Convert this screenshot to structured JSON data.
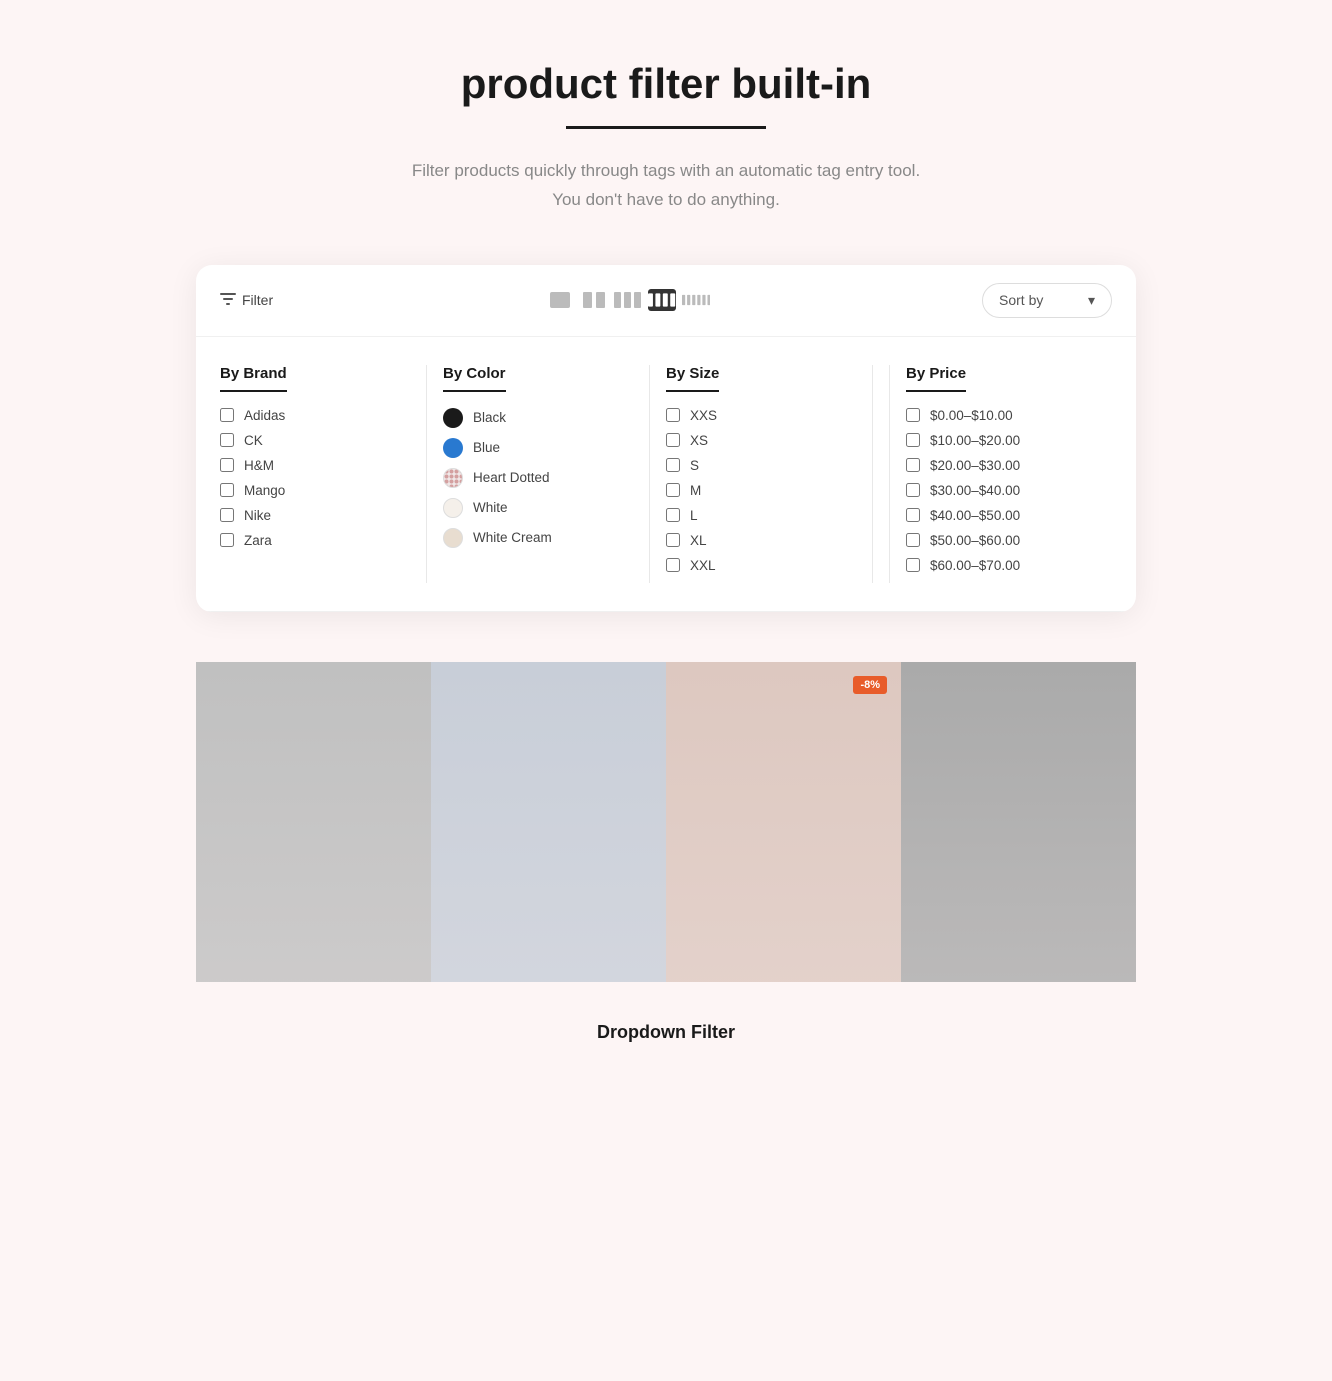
{
  "page": {
    "title": "product filter built-in",
    "subtitle_line1": "Filter products quickly through tags with an automatic tag entry tool.",
    "subtitle_line2": "You don't have to do anything.",
    "caption": "Dropdown Filter"
  },
  "toolbar": {
    "filter_label": "Filter",
    "sort_label": "Sort by"
  },
  "filter": {
    "brand": {
      "heading": "By Brand",
      "items": [
        "Adidas",
        "CK",
        "H&M",
        "Mango",
        "Nike",
        "Zara"
      ]
    },
    "color": {
      "heading": "By Color",
      "items": [
        {
          "name": "Black",
          "swatch": "black"
        },
        {
          "name": "Blue",
          "swatch": "blue"
        },
        {
          "name": "Heart Dotted",
          "swatch": "heart-dotted"
        },
        {
          "name": "White",
          "swatch": "white"
        },
        {
          "name": "White Cream",
          "swatch": "white-cream"
        }
      ]
    },
    "size": {
      "heading": "By Size",
      "items": [
        "XXS",
        "XS",
        "S",
        "M",
        "L",
        "XL",
        "XXL"
      ]
    },
    "price": {
      "heading": "By Price",
      "items": [
        "$0.00–$10.00",
        "$10.00–$20.00",
        "$20.00–$30.00",
        "$30.00–$40.00",
        "$40.00–$50.00",
        "$50.00–$60.00",
        "$60.00–$70.00"
      ]
    }
  },
  "products": [
    {
      "id": 1,
      "bg": "prod1",
      "discount": null
    },
    {
      "id": 2,
      "bg": "prod2",
      "discount": null
    },
    {
      "id": 3,
      "bg": "prod3",
      "discount": "-8%"
    },
    {
      "id": 4,
      "bg": "prod4",
      "discount": null
    }
  ]
}
